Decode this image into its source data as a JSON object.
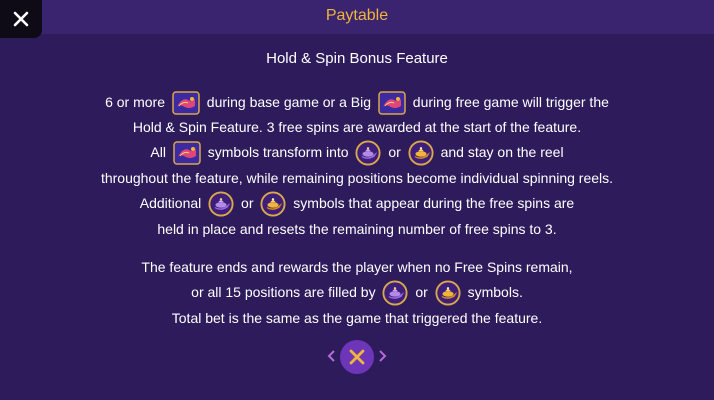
{
  "header": {
    "title": "Paytable"
  },
  "section": {
    "heading": "Hold & Spin Bonus Feature"
  },
  "text": {
    "l1a": "6 or more",
    "l1b": "during base game or a Big",
    "l1c": "during free game will trigger the",
    "l2": "Hold & Spin Feature. 3 free spins are awarded at the start of the feature.",
    "l3a": "All",
    "l3b": "symbols transform into",
    "l3c": "or",
    "l3d": "and stay on the reel",
    "l4": "throughout the feature, while remaining positions become individual spinning reels.",
    "l5a": "Additional",
    "l5b": "or",
    "l5c": "symbols that appear during the free spins are",
    "l6": "held in place and resets the remaining number of free spins to 3.",
    "p2l1": "The feature ends and rewards the player when no Free Spins remain,",
    "p2l2a": "or all 15 positions are filled by",
    "p2l2b": "or",
    "p2l2c": "symbols.",
    "p2l3": "Total bet is the same as the game that triggered the feature."
  },
  "icons": {
    "close": "close-icon",
    "carpet": "magic-carpet-symbol-icon",
    "lamp_purple": "purple-lamp-symbol-icon",
    "lamp_gold": "gold-lamp-symbol-icon",
    "prev": "chevron-left-icon",
    "next": "chevron-right-icon",
    "nav_close": "close-icon"
  },
  "colors": {
    "background": "#2e1b5c",
    "title": "#f0b53a",
    "nav_button": "#6d35b8"
  }
}
